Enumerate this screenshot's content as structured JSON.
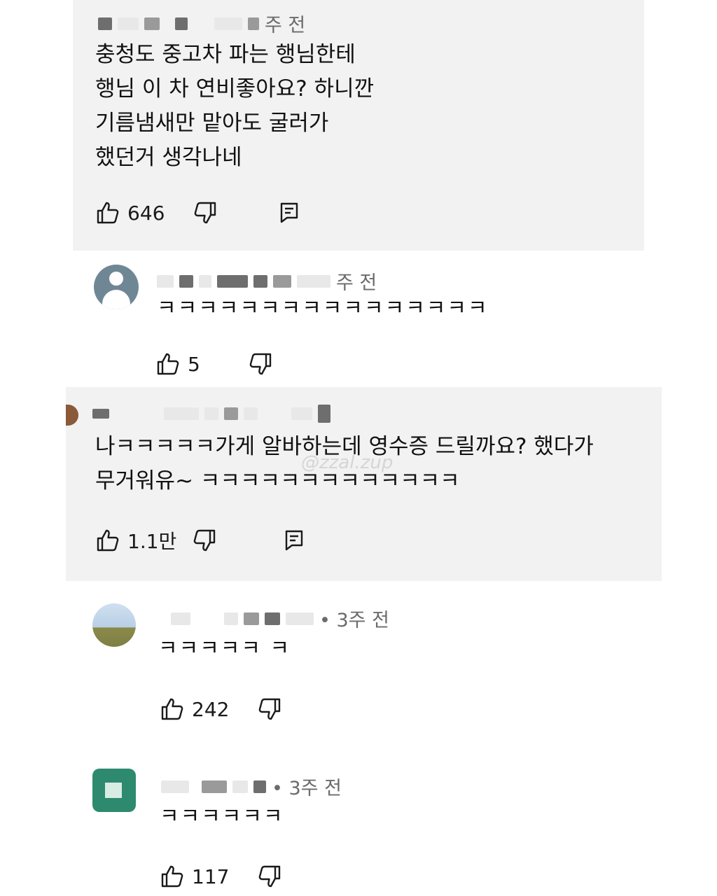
{
  "comments": [
    {
      "time": "주 전",
      "lines": [
        "충청도 중고차 파는 행님한테",
        "행님 이 차 연비좋아요? 하니깐",
        "기름냄새만 맡아도 굴러가",
        "했던거 생각나네"
      ],
      "likes": "646"
    },
    {
      "time": "주 전",
      "lines": [
        "ㅋㅋㅋㅋㅋㅋㅋㅋㅋㅋㅋㅋㅋㅋㅋㅋ"
      ],
      "likes": "5"
    },
    {
      "time": "",
      "lines": [
        "나ㅋㅋㅋㅋㅋ가게 알바하는데 영수증 드릴까요? 했다가",
        "무거워유~ ㅋㅋㅋㅋㅋㅋㅋㅋㅋㅋㅋㅋㅋ"
      ],
      "likes": "1.1만"
    },
    {
      "time": "• 3주 전",
      "lines": [
        "ㅋㅋㅋㅋㅋ ㅋ"
      ],
      "likes": "242"
    },
    {
      "time": "• 3주 전",
      "lines": [
        "ㅋㅋㅋㅋㅋㅋ"
      ],
      "likes": "117"
    }
  ],
  "watermark": "@zzal.zup",
  "icons": {
    "like": "thumbs-up-icon",
    "dislike": "thumbs-down-icon",
    "reply": "reply-icon"
  }
}
